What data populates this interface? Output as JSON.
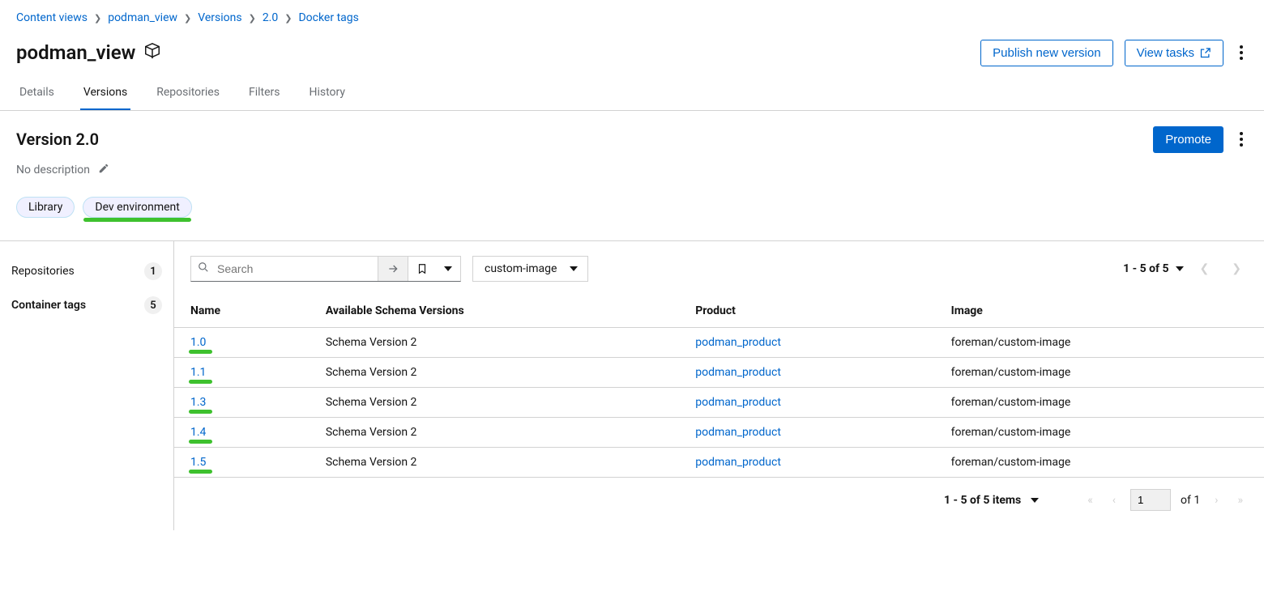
{
  "breadcrumb": [
    {
      "label": "Content views"
    },
    {
      "label": "podman_view"
    },
    {
      "label": "Versions"
    },
    {
      "label": "2.0"
    },
    {
      "label": "Docker tags"
    }
  ],
  "page": {
    "title": "podman_view",
    "publish_label": "Publish new version",
    "view_tasks_label": "View tasks"
  },
  "tabs": [
    {
      "label": "Details"
    },
    {
      "label": "Versions"
    },
    {
      "label": "Repositories"
    },
    {
      "label": "Filters"
    },
    {
      "label": "History"
    }
  ],
  "subheader": {
    "title": "Version 2.0",
    "promote_label": "Promote",
    "description": "No description"
  },
  "chips": [
    {
      "label": "Library",
      "annotated": false
    },
    {
      "label": "Dev environment",
      "annotated": true
    }
  ],
  "side_nav": [
    {
      "label": "Repositories",
      "count": "1",
      "active": false
    },
    {
      "label": "Container tags",
      "count": "5",
      "active": true
    }
  ],
  "toolbar": {
    "search_placeholder": "Search",
    "repo_select": "custom-image",
    "range_text": "1 - 5 of 5"
  },
  "table": {
    "headers": [
      "Name",
      "Available Schema Versions",
      "Product",
      "Image"
    ],
    "rows": [
      {
        "name": "1.0",
        "schema": "Schema Version 2",
        "product": "podman_product",
        "image": "foreman/custom-image"
      },
      {
        "name": "1.1",
        "schema": "Schema Version 2",
        "product": "podman_product",
        "image": "foreman/custom-image"
      },
      {
        "name": "1.3",
        "schema": "Schema Version 2",
        "product": "podman_product",
        "image": "foreman/custom-image"
      },
      {
        "name": "1.4",
        "schema": "Schema Version 2",
        "product": "podman_product",
        "image": "foreman/custom-image"
      },
      {
        "name": "1.5",
        "schema": "Schema Version 2",
        "product": "podman_product",
        "image": "foreman/custom-image"
      }
    ]
  },
  "footer": {
    "range_text": "1 - 5 of 5 items",
    "page_value": "1",
    "of_text": "of 1"
  }
}
